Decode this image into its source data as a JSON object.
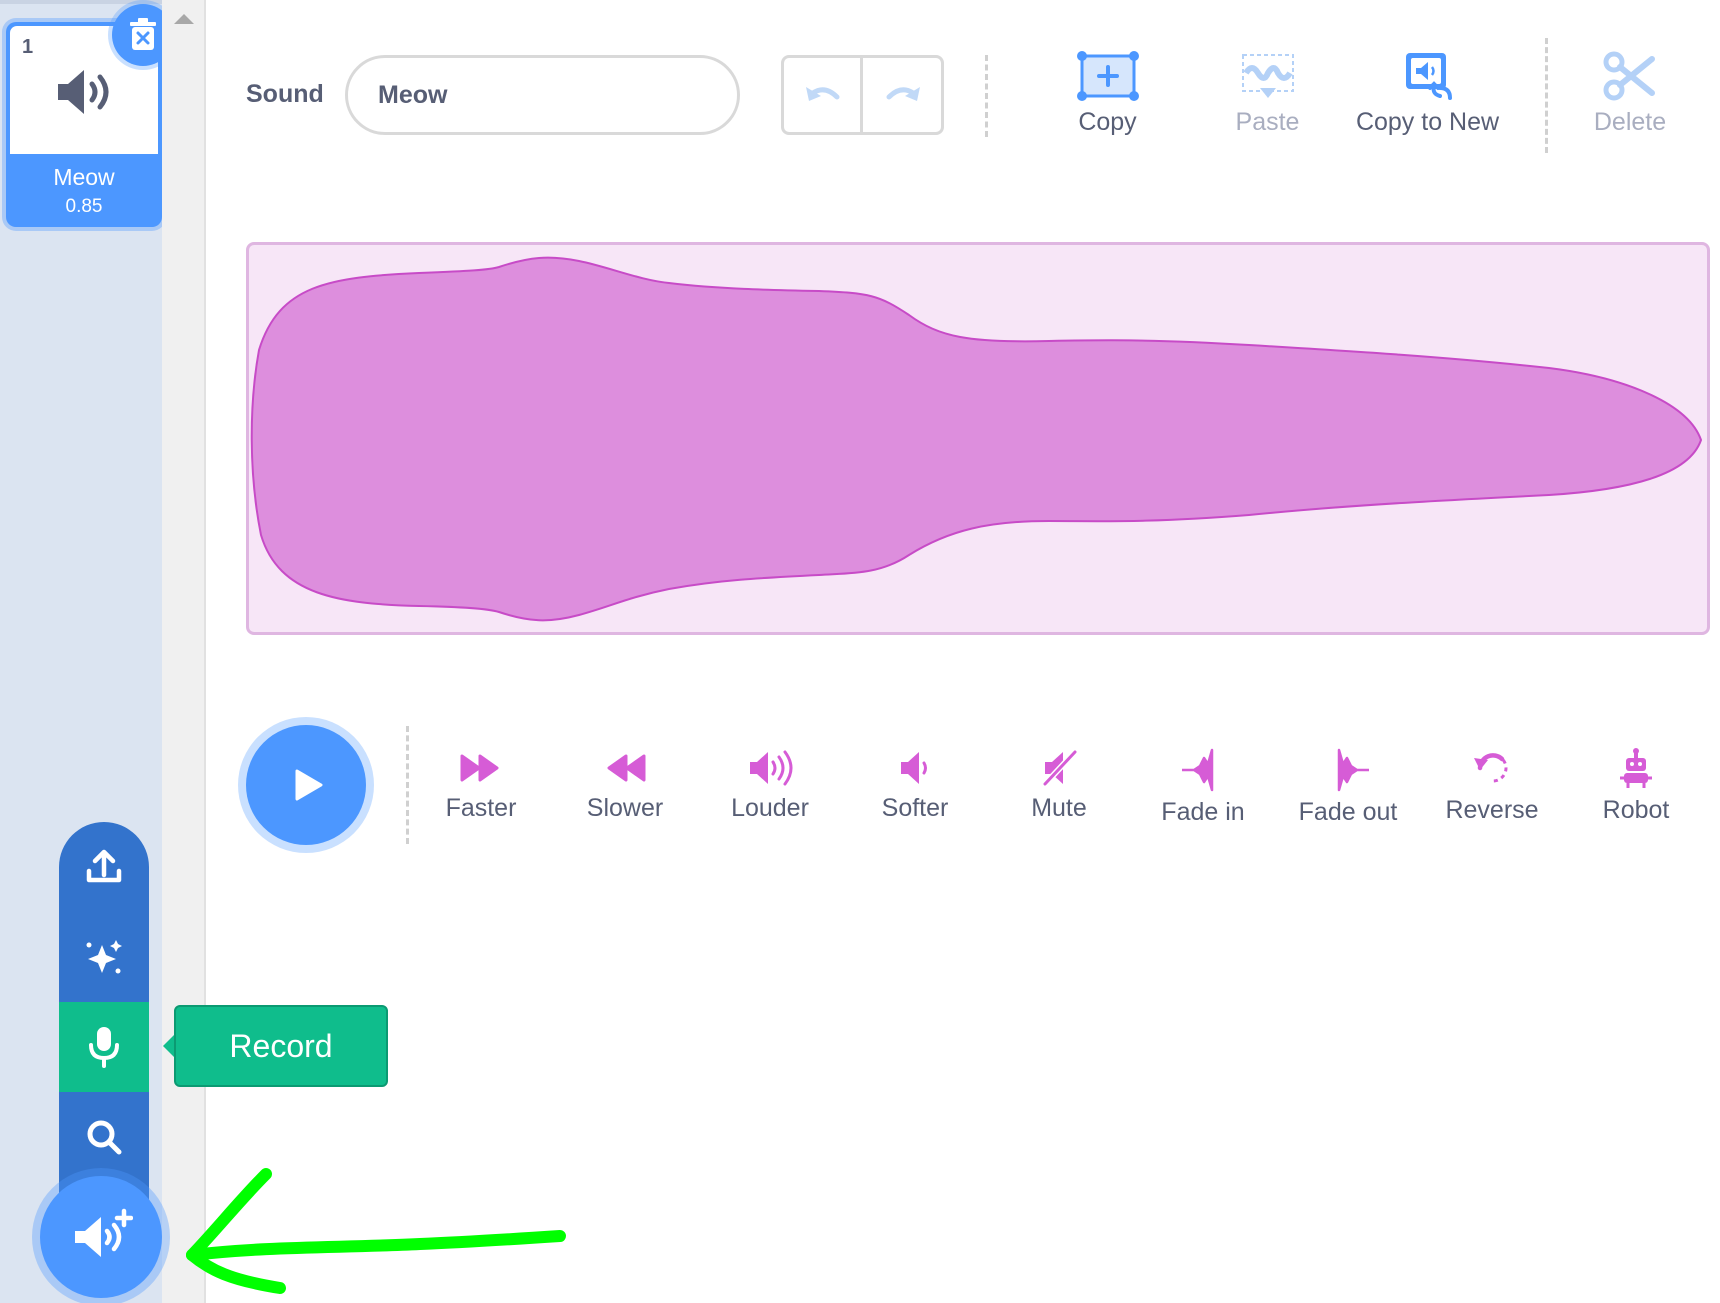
{
  "sound_list": {
    "selected_sound": {
      "number": "1",
      "name": "Meow",
      "duration": "0.85"
    }
  },
  "add_sound_menu": {
    "items": [
      "upload-sound",
      "surprise",
      "record",
      "choose-sound"
    ],
    "tooltip": "Record"
  },
  "editor": {
    "sound_label": "Sound",
    "sound_name_value": "Meow",
    "toolbar": {
      "copy": "Copy",
      "paste": "Paste",
      "copy_to_new": "Copy to New",
      "delete": "Delete"
    },
    "effects": [
      "Faster",
      "Slower",
      "Louder",
      "Softer",
      "Mute",
      "Fade in",
      "Fade out",
      "Reverse",
      "Robot"
    ]
  },
  "colors": {
    "accent_blue": "#4c97ff",
    "menu_blue": "#3373cc",
    "record_green": "#0fbd8c",
    "waveform_fill": "#dd8edd",
    "waveform_stroke": "#c74bc7",
    "effect_icon": "#d65cd6",
    "annotation_green": "#00ff00"
  }
}
